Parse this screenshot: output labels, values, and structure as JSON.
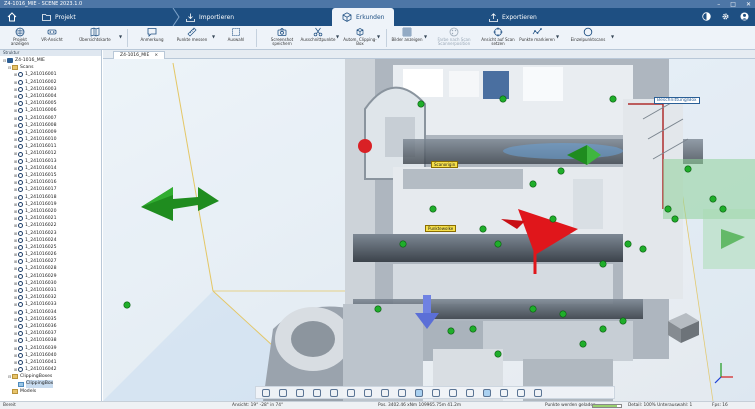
{
  "window": {
    "title": "Z4-1016_MIE - SCENE 2023.1.0"
  },
  "nav": {
    "tabs": [
      {
        "label": "Projekt"
      },
      {
        "label": "Importieren"
      },
      {
        "label": "Erkunden"
      },
      {
        "label": "Exportieren"
      }
    ],
    "colors": {
      "bar": "#1e4f82",
      "active": "#eef3f9"
    }
  },
  "ribbon": {
    "buttons": [
      "Projekt anzeigen",
      "VR-Ansicht",
      "Übersichtskarte",
      "Anmerkung",
      "Punkte messen",
      "Auswahl",
      "Screenshot speichern",
      "Ausschnittpunkte",
      "Autom. Clipping-Box",
      "Bilder anzeigen",
      "Farbe nach Scan Scannerposition",
      "Ansicht auf Scan setzen",
      "Punkte markieren",
      "Einzelpunktscans"
    ]
  },
  "panel": {
    "header": "Struktur"
  },
  "tree": {
    "root": "Z4-1016_MIE",
    "scans_folder": "Scans",
    "scans": [
      "1_241016001",
      "1_241016002",
      "1_241016003",
      "1_241016004",
      "1_241016005",
      "1_241016006",
      "1_241016007",
      "1_241016008",
      "1_241016009",
      "1_241016010",
      "1_241016011",
      "1_241016012",
      "1_241016013",
      "1_241016014",
      "1_241016015",
      "1_241016016",
      "1_241016017",
      "1_241016018",
      "1_241016019",
      "1_241016020",
      "1_241016021",
      "1_241016022",
      "1_241016023",
      "1_241016024",
      "1_241016025",
      "1_241016026",
      "1_241016027",
      "1_241016028",
      "1_241016029",
      "1_241016030",
      "1_241016031",
      "1_241016032",
      "1_241016033",
      "1_241016034",
      "1_241016035",
      "1_241016036",
      "1_241016037",
      "1_241016038",
      "1_241016039",
      "1_241016040",
      "1_241016041",
      "1_241016042"
    ],
    "clipping_folder": "ClippingBoxes",
    "clipping_item": "ClippingBox",
    "models_folder": "Models"
  },
  "viewtab": {
    "label": "Z4-1016_MIE",
    "close": "×"
  },
  "viewport": {
    "label_clipping": "Beschnittung/Box",
    "label_yellow1": "Scanorigin",
    "label_yellow2": "Punktewolke"
  },
  "status": {
    "left": "Bereit",
    "view": "Ansicht: 19° -28° in 74°",
    "position": "Pos. 3402.46 xNm 109965.75m 41.2m",
    "loading": "Punkte werden geladen...",
    "detail": "Detail: 100% Unterauswahl: 1",
    "fps": "Fps: 16",
    "progress": 0.85
  }
}
